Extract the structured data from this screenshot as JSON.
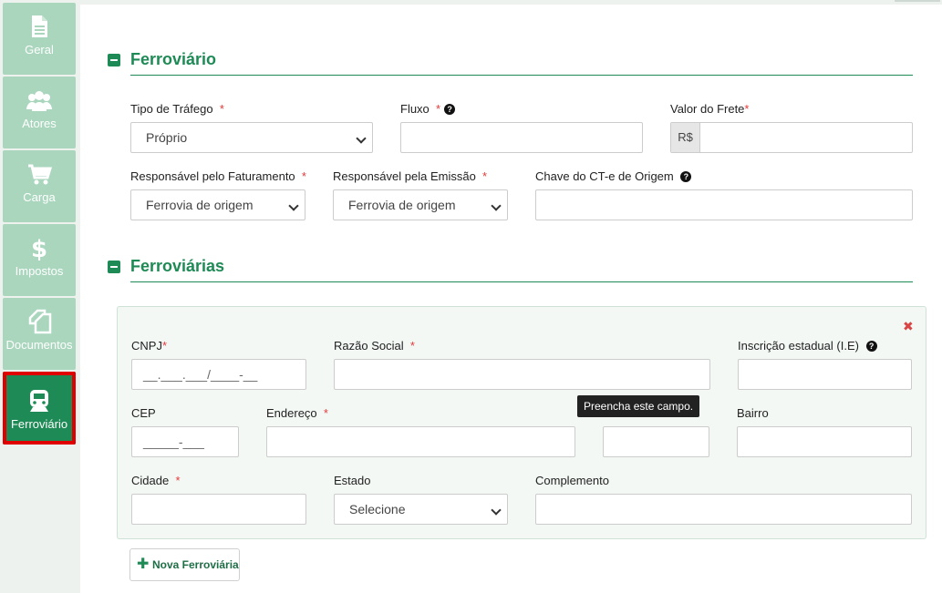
{
  "sidebar": {
    "items": [
      {
        "label": "Geral",
        "icon": "document-icon"
      },
      {
        "label": "Atores",
        "icon": "users-icon"
      },
      {
        "label": "Carga",
        "icon": "cart-icon"
      },
      {
        "label": "Impostos",
        "icon": "dollar-icon"
      },
      {
        "label": "Documentos",
        "icon": "copy-icon"
      },
      {
        "label": "Ferroviário",
        "icon": "train-icon",
        "active": true
      }
    ]
  },
  "section_ferroviario": {
    "title": "Ferroviário",
    "tipo_trafego": {
      "label": "Tipo de Tráfego",
      "required": "*",
      "value": "Próprio"
    },
    "fluxo": {
      "label": "Fluxo",
      "required": "*",
      "value": ""
    },
    "valor_frete": {
      "label": "Valor do Frete",
      "required": "*",
      "addon": "R$",
      "value": ""
    },
    "resp_faturamento": {
      "label": "Responsável pelo Faturamento",
      "required": "*",
      "value": "Ferrovia de origem"
    },
    "resp_emissao": {
      "label": "Responsável pela Emissão",
      "required": "*",
      "value": "Ferrovia de origem"
    },
    "chave_cte": {
      "label": "Chave do CT-e de Origem",
      "value": ""
    }
  },
  "section_ferroviarias": {
    "title": "Ferroviárias",
    "remove_icon": "close-icon",
    "cnpj": {
      "label": "CNPJ",
      "required": "*",
      "placeholder": "__.___.___/____-__"
    },
    "razao_social": {
      "label": "Razão Social",
      "required": "*",
      "value": ""
    },
    "inscricao": {
      "label": "Inscrição estadual (I.E)",
      "value": ""
    },
    "cep": {
      "label": "CEP",
      "placeholder": "_____-___"
    },
    "endereco": {
      "label": "Endereço",
      "required": "*",
      "value": ""
    },
    "numero": {
      "value": ""
    },
    "bairro": {
      "label": "Bairro",
      "value": ""
    },
    "cidade": {
      "label": "Cidade",
      "required": "*",
      "value": ""
    },
    "estado": {
      "label": "Estado",
      "value": "Selecione"
    },
    "complemento": {
      "label": "Complemento",
      "value": ""
    },
    "tooltip": "Preencha este campo.",
    "add_button": "Nova Ferroviária"
  },
  "colors": {
    "accent": "#1e8a55",
    "required": "#e23a3a",
    "highlight": "#e00000"
  }
}
